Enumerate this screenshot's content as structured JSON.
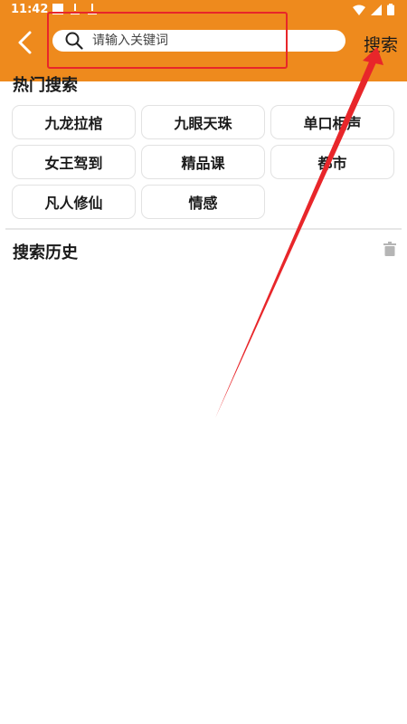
{
  "status_bar": {
    "time": "11:42"
  },
  "header": {
    "back_icon": "chevron-left-icon",
    "search": {
      "placeholder": "请输入关键词",
      "value": "",
      "icon": "search-icon"
    },
    "search_button_label": "搜索"
  },
  "hot_search": {
    "title": "热门搜索",
    "tags": [
      "九龙拉棺",
      "九眼天珠",
      "单口相声",
      "女王驾到",
      "精品课",
      "都市",
      "凡人修仙",
      "情感"
    ]
  },
  "history": {
    "title": "搜索历史",
    "clear_icon": "trash-icon"
  },
  "colors": {
    "header_bg": "#ee8a1d",
    "annotation_red": "#e8262a"
  }
}
